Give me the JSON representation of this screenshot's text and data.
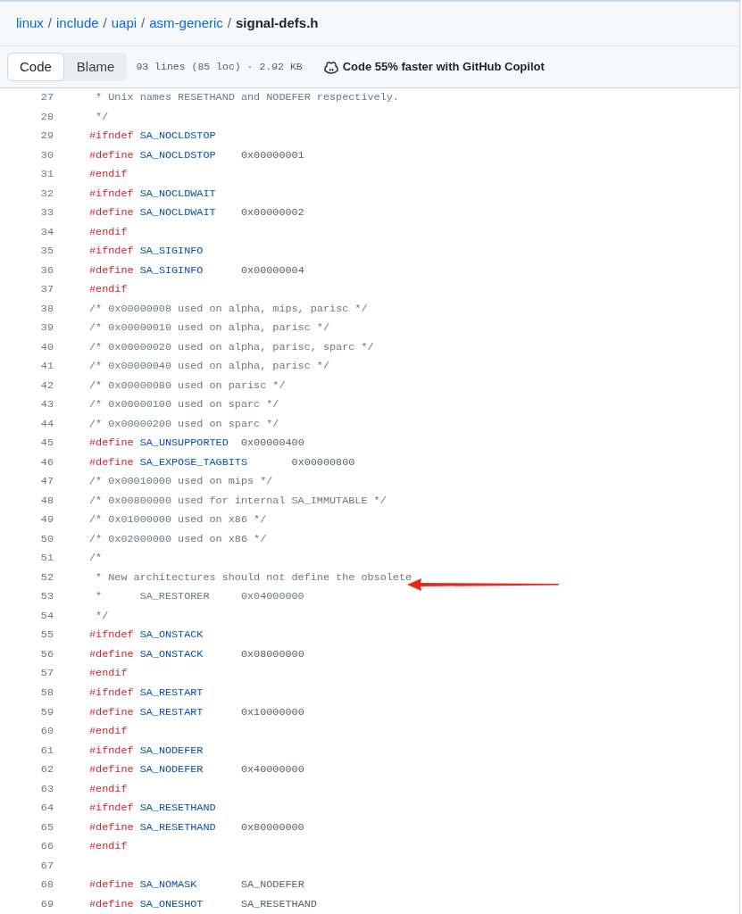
{
  "breadcrumb": [
    {
      "text": "linux",
      "kind": "link",
      "separator": "/"
    },
    {
      "text": "include",
      "kind": "link",
      "separator": "/"
    },
    {
      "text": "uapi",
      "kind": "link",
      "separator": "/"
    },
    {
      "text": "asm-generic",
      "kind": "link",
      "separator": "/"
    },
    {
      "text": "signal-defs.h",
      "kind": "current"
    }
  ],
  "view_tabs": [
    {
      "label": "Code",
      "selected": true
    },
    {
      "label": "Blame",
      "selected": false
    }
  ],
  "file_info": "93 lines (85 loc) · 2.92 KB",
  "copilot_promo": "Code 55% faster with GitHub Copilot",
  "code_lines": [
    {
      "number": "27",
      "tokens": [
        {
          "kind": "comment",
          "text": " * Unix names RESETHAND and NODEFER respectively."
        }
      ]
    },
    {
      "number": "28",
      "tokens": [
        {
          "kind": "comment",
          "text": " */"
        }
      ]
    },
    {
      "number": "29",
      "tokens": [
        {
          "kind": "keyword",
          "text": "#ifndef"
        },
        {
          "kind": "macro",
          "text": " SA_NOCLDSTOP"
        }
      ]
    },
    {
      "number": "30",
      "tokens": [
        {
          "kind": "keyword",
          "text": "#define"
        },
        {
          "kind": "macro",
          "text": " SA_NOCLDSTOP"
        },
        {
          "kind": "plain",
          "text": "    0x00000001"
        }
      ]
    },
    {
      "number": "31",
      "tokens": [
        {
          "kind": "keyword",
          "text": "#endif"
        }
      ]
    },
    {
      "number": "32",
      "tokens": [
        {
          "kind": "keyword",
          "text": "#ifndef"
        },
        {
          "kind": "macro",
          "text": " SA_NOCLDWAIT"
        }
      ]
    },
    {
      "number": "33",
      "tokens": [
        {
          "kind": "keyword",
          "text": "#define"
        },
        {
          "kind": "macro",
          "text": " SA_NOCLDWAIT"
        },
        {
          "kind": "plain",
          "text": "    0x00000002"
        }
      ]
    },
    {
      "number": "34",
      "tokens": [
        {
          "kind": "keyword",
          "text": "#endif"
        }
      ]
    },
    {
      "number": "35",
      "tokens": [
        {
          "kind": "keyword",
          "text": "#ifndef"
        },
        {
          "kind": "macro",
          "text": " SA_SIGINFO"
        }
      ]
    },
    {
      "number": "36",
      "tokens": [
        {
          "kind": "keyword",
          "text": "#define"
        },
        {
          "kind": "macro",
          "text": " SA_SIGINFO"
        },
        {
          "kind": "plain",
          "text": "      0x00000004"
        }
      ]
    },
    {
      "number": "37",
      "tokens": [
        {
          "kind": "keyword",
          "text": "#endif"
        }
      ]
    },
    {
      "number": "38",
      "tokens": [
        {
          "kind": "comment",
          "text": "/* 0x00000008 used on alpha, mips, parisc */"
        }
      ]
    },
    {
      "number": "39",
      "tokens": [
        {
          "kind": "comment",
          "text": "/* 0x00000010 used on alpha, parisc */"
        }
      ]
    },
    {
      "number": "40",
      "tokens": [
        {
          "kind": "comment",
          "text": "/* 0x00000020 used on alpha, parisc, sparc */"
        }
      ]
    },
    {
      "number": "41",
      "tokens": [
        {
          "kind": "comment",
          "text": "/* 0x00000040 used on alpha, parisc */"
        }
      ]
    },
    {
      "number": "42",
      "tokens": [
        {
          "kind": "comment",
          "text": "/* 0x00000080 used on parisc */"
        }
      ]
    },
    {
      "number": "43",
      "tokens": [
        {
          "kind": "comment",
          "text": "/* 0x00000100 used on sparc */"
        }
      ]
    },
    {
      "number": "44",
      "tokens": [
        {
          "kind": "comment",
          "text": "/* 0x00000200 used on sparc */"
        }
      ]
    },
    {
      "number": "45",
      "tokens": [
        {
          "kind": "keyword",
          "text": "#define"
        },
        {
          "kind": "macro",
          "text": " SA_UNSUPPORTED"
        },
        {
          "kind": "plain",
          "text": "  0x00000400"
        }
      ]
    },
    {
      "number": "46",
      "tokens": [
        {
          "kind": "keyword",
          "text": "#define"
        },
        {
          "kind": "macro",
          "text": " SA_EXPOSE_TAGBITS"
        },
        {
          "kind": "plain",
          "text": "       0x00000800"
        }
      ]
    },
    {
      "number": "47",
      "tokens": [
        {
          "kind": "comment",
          "text": "/* 0x00010000 used on mips */"
        }
      ]
    },
    {
      "number": "48",
      "tokens": [
        {
          "kind": "comment",
          "text": "/* 0x00800000 used for internal SA_IMMUTABLE */"
        }
      ]
    },
    {
      "number": "49",
      "tokens": [
        {
          "kind": "comment",
          "text": "/* 0x01000000 used on x86 */"
        }
      ]
    },
    {
      "number": "50",
      "tokens": [
        {
          "kind": "comment",
          "text": "/* 0x02000000 used on x86 */"
        }
      ]
    },
    {
      "number": "51",
      "tokens": [
        {
          "kind": "comment",
          "text": "/*"
        }
      ]
    },
    {
      "number": "52",
      "tokens": [
        {
          "kind": "comment",
          "text": " * New architectures should not define the obsolete"
        }
      ]
    },
    {
      "number": "53",
      "tokens": [
        {
          "kind": "comment",
          "text": " *      SA_RESTORER     0x04000000"
        }
      ]
    },
    {
      "number": "54",
      "tokens": [
        {
          "kind": "comment",
          "text": " */"
        }
      ]
    },
    {
      "number": "55",
      "tokens": [
        {
          "kind": "keyword",
          "text": "#ifndef"
        },
        {
          "kind": "macro",
          "text": " SA_ONSTACK"
        }
      ]
    },
    {
      "number": "56",
      "tokens": [
        {
          "kind": "keyword",
          "text": "#define"
        },
        {
          "kind": "macro",
          "text": " SA_ONSTACK"
        },
        {
          "kind": "plain",
          "text": "      0x08000000"
        }
      ]
    },
    {
      "number": "57",
      "tokens": [
        {
          "kind": "keyword",
          "text": "#endif"
        }
      ]
    },
    {
      "number": "58",
      "tokens": [
        {
          "kind": "keyword",
          "text": "#ifndef"
        },
        {
          "kind": "macro",
          "text": " SA_RESTART"
        }
      ]
    },
    {
      "number": "59",
      "tokens": [
        {
          "kind": "keyword",
          "text": "#define"
        },
        {
          "kind": "macro",
          "text": " SA_RESTART"
        },
        {
          "kind": "plain",
          "text": "      0x10000000"
        }
      ]
    },
    {
      "number": "60",
      "tokens": [
        {
          "kind": "keyword",
          "text": "#endif"
        }
      ]
    },
    {
      "number": "61",
      "tokens": [
        {
          "kind": "keyword",
          "text": "#ifndef"
        },
        {
          "kind": "macro",
          "text": " SA_NODEFER"
        }
      ]
    },
    {
      "number": "62",
      "tokens": [
        {
          "kind": "keyword",
          "text": "#define"
        },
        {
          "kind": "macro",
          "text": " SA_NODEFER"
        },
        {
          "kind": "plain",
          "text": "      0x40000000"
        }
      ]
    },
    {
      "number": "63",
      "tokens": [
        {
          "kind": "keyword",
          "text": "#endif"
        }
      ]
    },
    {
      "number": "64",
      "tokens": [
        {
          "kind": "keyword",
          "text": "#ifndef"
        },
        {
          "kind": "macro",
          "text": " SA_RESETHAND"
        }
      ]
    },
    {
      "number": "65",
      "tokens": [
        {
          "kind": "keyword",
          "text": "#define"
        },
        {
          "kind": "macro",
          "text": " SA_RESETHAND"
        },
        {
          "kind": "plain",
          "text": "    0x80000000"
        }
      ]
    },
    {
      "number": "66",
      "tokens": [
        {
          "kind": "keyword",
          "text": "#endif"
        }
      ]
    },
    {
      "number": "67"
    },
    {
      "number": "68",
      "tokens": [
        {
          "kind": "keyword",
          "text": "#define"
        },
        {
          "kind": "macro",
          "text": " SA_NOMASK"
        },
        {
          "kind": "plain",
          "text": "       SA_NODEFER"
        }
      ]
    },
    {
      "number": "69",
      "tokens": [
        {
          "kind": "keyword",
          "text": "#define"
        },
        {
          "kind": "macro",
          "text": " SA_ONESHOT"
        },
        {
          "kind": "plain",
          "text": "      SA_RESETHAND"
        }
      ]
    }
  ]
}
